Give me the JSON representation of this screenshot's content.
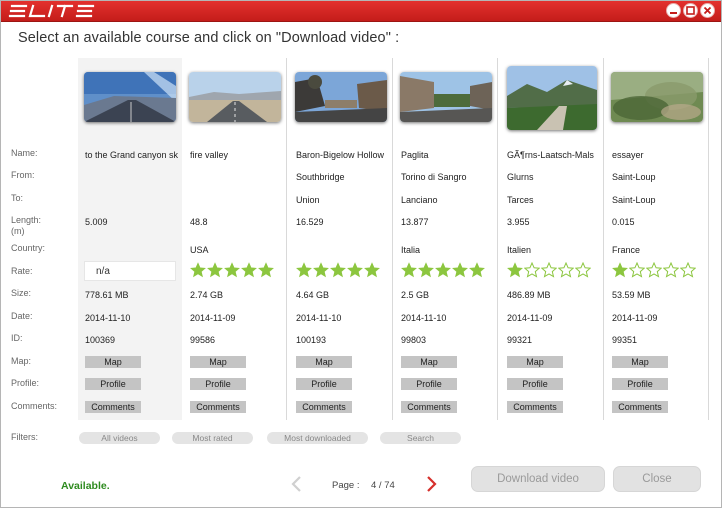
{
  "app": {
    "logo_text": "ELITE",
    "colors": {
      "brand": "#d62a27",
      "rating_star": "#8cc63f",
      "status_ok": "#2e8b1f"
    },
    "window_buttons": [
      "minimize-icon",
      "maximize-icon",
      "close-icon"
    ]
  },
  "heading": "Select an available course and click on \"Download video\" :",
  "labels": {
    "name": "Name:",
    "from": "From:",
    "to": "To:",
    "length": "Length:",
    "length_unit": "(m)",
    "country": "Country:",
    "rate": "Rate:",
    "size": "Size:",
    "date": "Date:",
    "id": "ID:",
    "map": "Map:",
    "profile": "Profile:",
    "comments": "Comments:",
    "filters": "Filters:"
  },
  "courses": [
    {
      "name": "to the Grand canyon sk",
      "from": "",
      "to": "",
      "length": "5.009",
      "country": "",
      "rating": null,
      "rating_text": "n/a",
      "size": "778.61 MB",
      "date": "2014-11-10",
      "id": "100369",
      "map_label": "Map",
      "profile_label": "Profile",
      "comments_label": "Comments",
      "thumb_scene": "desert-road"
    },
    {
      "name": "fire valley",
      "from": "",
      "to": "",
      "length": "48.8",
      "country": "USA",
      "rating": 5,
      "rating_text": "",
      "size": "2.74 GB",
      "date": "2014-11-09",
      "id": "99586",
      "map_label": "Map",
      "profile_label": "Profile",
      "comments_label": "Comments",
      "thumb_scene": "valley-road"
    },
    {
      "name": "Baron-Bigelow Hollow",
      "from": "Southbridge",
      "to": "Union",
      "length": "16.529",
      "country": "",
      "rating": 5,
      "rating_text": "",
      "size": "4.64 GB",
      "date": "2014-11-10",
      "id": "100193",
      "map_label": "Map",
      "profile_label": "Profile",
      "comments_label": "Comments",
      "thumb_scene": "town-street"
    },
    {
      "name": "Paglita",
      "from": "Torino di Sangro",
      "to": "Lanciano",
      "length": "13.877",
      "country": "Italia",
      "rating": 5,
      "rating_text": "",
      "size": "2.5 GB",
      "date": "2014-11-10",
      "id": "99803",
      "map_label": "Map",
      "profile_label": "Profile",
      "comments_label": "Comments",
      "thumb_scene": "village-road"
    },
    {
      "name": "GÃ¶rns-Laatsch-Mals",
      "from": "Glurns",
      "to": "Tarces",
      "length": "3.955",
      "country": "Italien",
      "rating": 1,
      "rating_text": "",
      "size": "486.89 MB",
      "date": "2014-11-09",
      "id": "99321",
      "map_label": "Map",
      "profile_label": "Profile",
      "comments_label": "Comments",
      "thumb_scene": "mountain-path"
    },
    {
      "name": "essayer",
      "from": "Saint-Loup",
      "to": "Saint-Loup",
      "length": "0.015",
      "country": "France",
      "rating": 1,
      "rating_text": "",
      "size": "53.59 MB",
      "date": "2014-11-09",
      "id": "99351",
      "map_label": "Map",
      "profile_label": "Profile",
      "comments_label": "Comments",
      "thumb_scene": "blurry-forest"
    }
  ],
  "filters": [
    "All videos",
    "Most rated",
    "Most downloaded",
    "Search"
  ],
  "footer": {
    "status": "Available.",
    "page_label": "Page :",
    "page_current": "4",
    "page_total": "74",
    "page_text": "4 / 74",
    "download_label": "Download video",
    "close_label": "Close"
  }
}
